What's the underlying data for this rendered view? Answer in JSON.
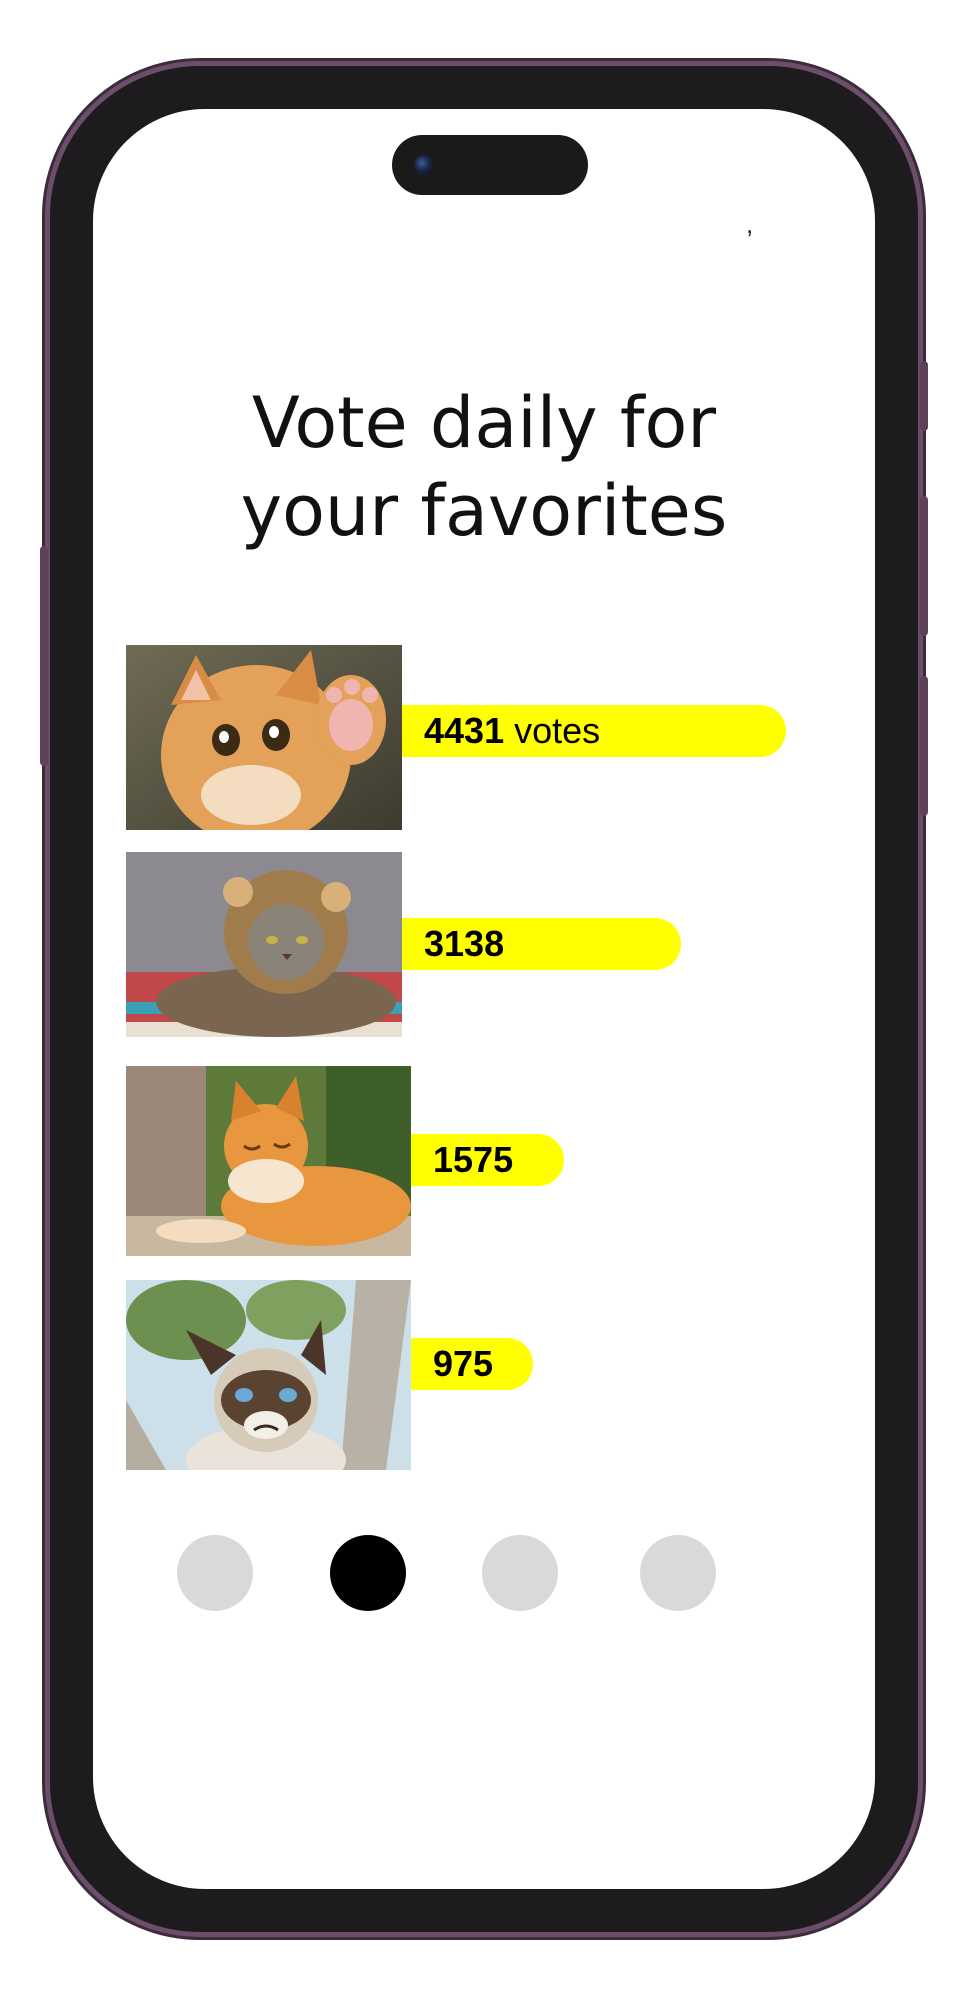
{
  "status_mark": ",",
  "heading": {
    "line1": "Vote daily for",
    "line2": "your favorites"
  },
  "votes": [
    {
      "count": "4431",
      "unit": "votes",
      "photo": "orange kitten waving paw",
      "fraction": 1.0
    },
    {
      "count": "3138",
      "unit": "",
      "photo": "cat in lion mane costume",
      "fraction": 0.7
    },
    {
      "count": "1575",
      "unit": "",
      "photo": "ginger cat lying down",
      "fraction": 0.36
    },
    {
      "count": "975",
      "unit": "",
      "photo": "grumpy cat in tree",
      "fraction": 0.22
    }
  ],
  "pagination": {
    "pages": 4,
    "active_index": 1
  },
  "colors": {
    "bar": "#ffff00",
    "dot_active": "#000000",
    "dot_inactive": "#d9d9d9",
    "frame": "#1d1b1e"
  }
}
